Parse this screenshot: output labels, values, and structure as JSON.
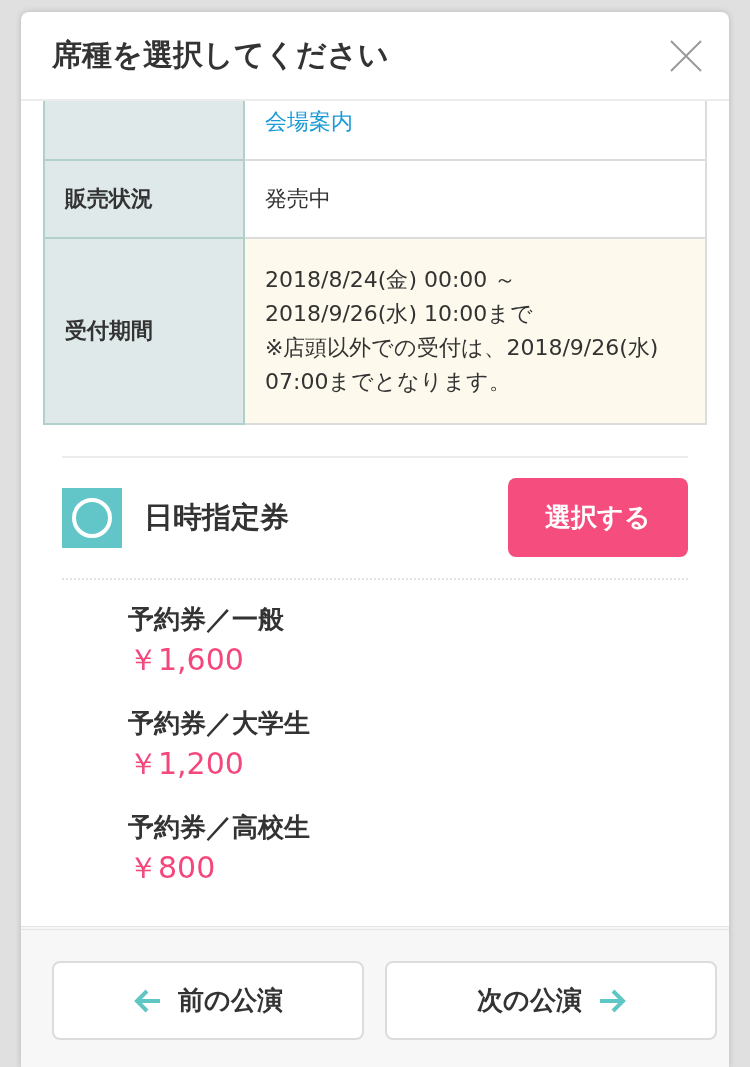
{
  "dialog": {
    "title": "席種を選択してください"
  },
  "info_table": {
    "rows": [
      {
        "kind": "link",
        "value": [
          "会場案内"
        ],
        "highlighted": false
      },
      {
        "kind": "text",
        "label": "販売状況",
        "value": [
          "発売中"
        ],
        "highlighted": false
      },
      {
        "kind": "text",
        "label": "受付期間",
        "value": [
          "2018/8/24(金) 00:00 ～",
          "2018/9/26(水) 10:00まで",
          "※店頭以外での受付は、2018/9/26(水) 07:00までとなります。"
        ],
        "highlighted": true
      }
    ]
  },
  "seat_types": [
    {
      "name": "日時指定券",
      "select_button": "選択する",
      "prices": [
        {
          "name": "予約券／一般",
          "price": "￥1,600"
        },
        {
          "name": "予約券／大学生",
          "price": "￥1,200"
        },
        {
          "name": "予約券／高校生",
          "price": "￥800"
        }
      ]
    }
  ],
  "nav_buttons": [
    {
      "kind": "prev",
      "label": "前の公演"
    },
    {
      "kind": "next",
      "label": "次の公演"
    }
  ]
}
